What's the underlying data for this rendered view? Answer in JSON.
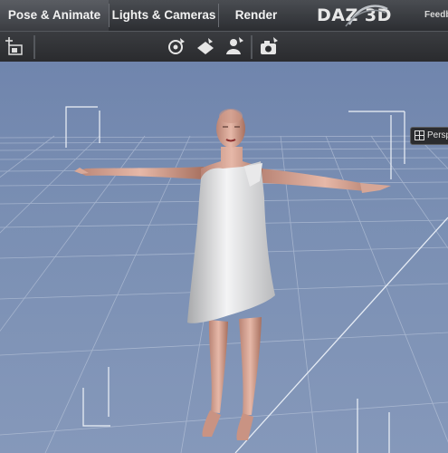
{
  "tabs": [
    {
      "label": "Pose & Animate",
      "active": true
    },
    {
      "label": "Lights & Cameras",
      "active": false
    },
    {
      "label": "Render",
      "active": false
    }
  ],
  "brand": {
    "logo_text": "DAZ 3D",
    "feedback_label": "Feedb"
  },
  "toolbar": {
    "icons": [
      "scene-content-icon",
      "rotate-figure-icon",
      "apply-pose-icon",
      "figure-select-icon",
      "camera-icon"
    ]
  },
  "viewport": {
    "camera_label": "Persp",
    "camera_icon": "viewport-camera-icon",
    "background_color": "#7a8fb3",
    "grid_color": "#c9d3e4"
  }
}
